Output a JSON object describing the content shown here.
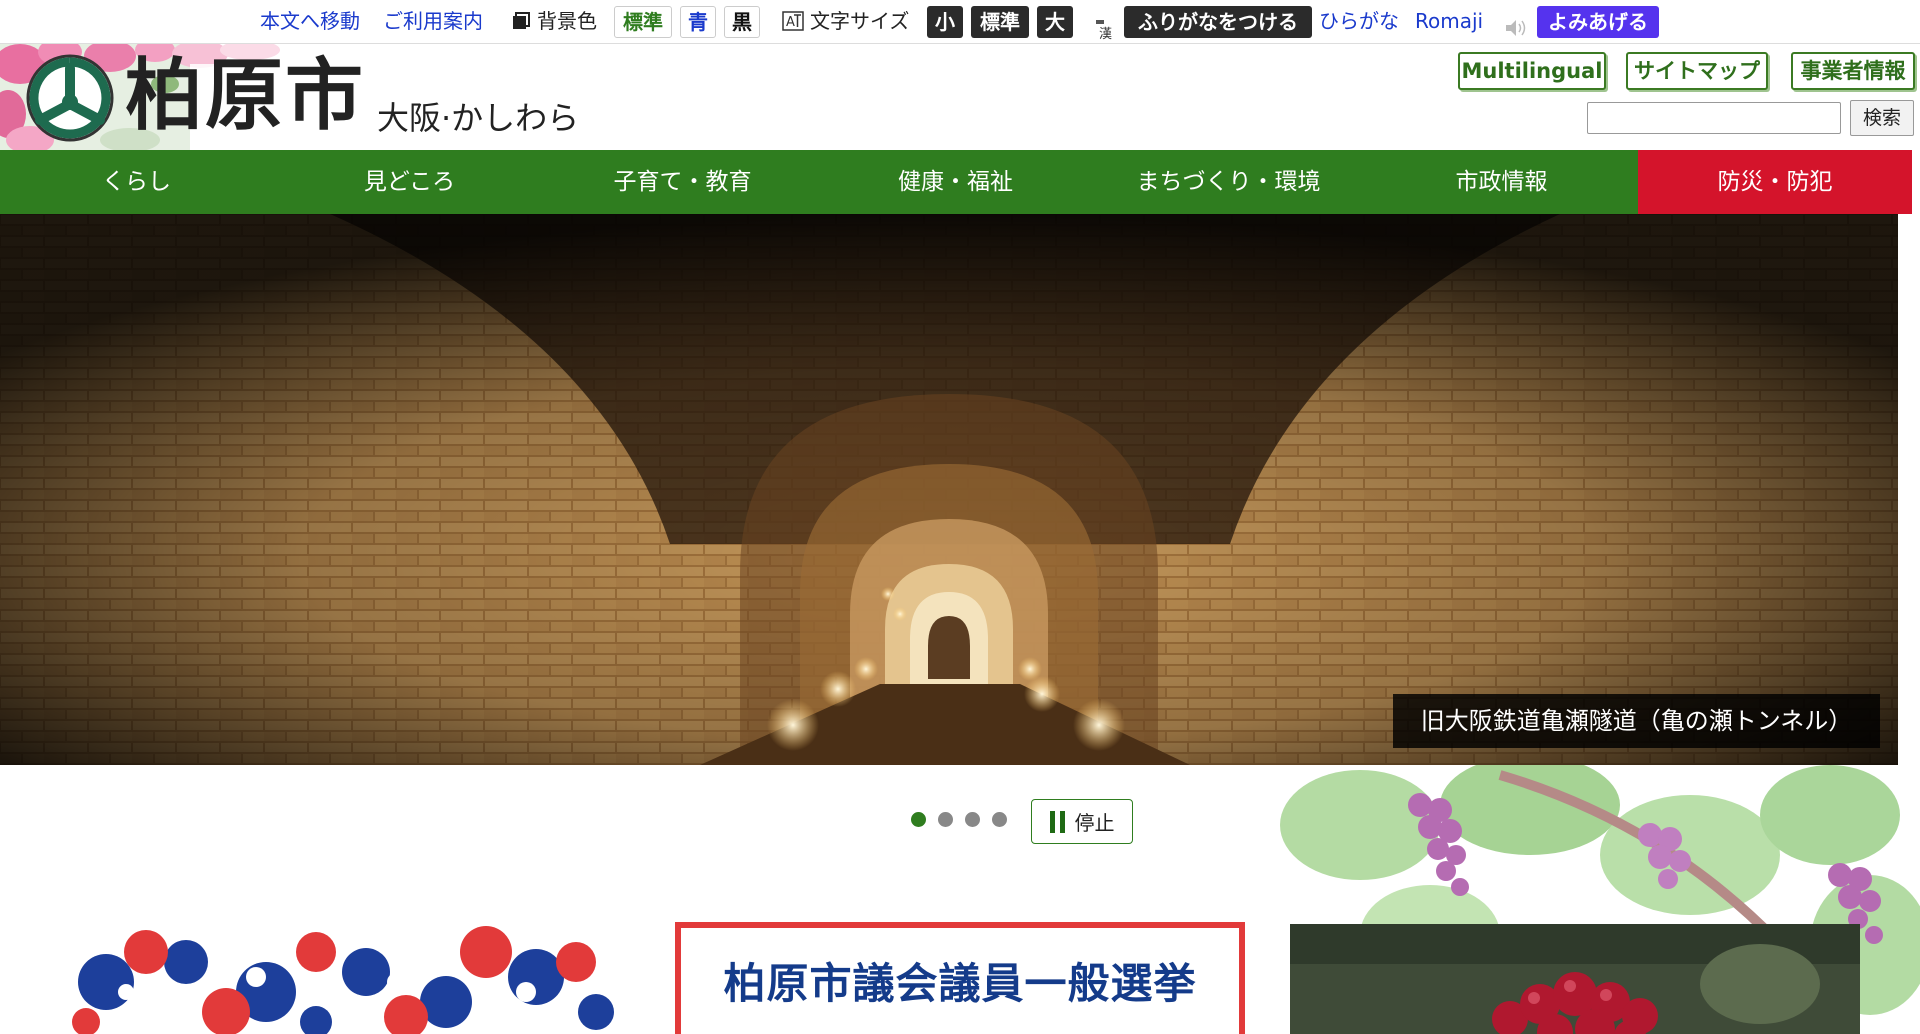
{
  "util": {
    "skip_link": "本文へ移動",
    "guide_link": "ご利用案内",
    "bg_label": "背景色",
    "bg_standard": "標準",
    "bg_blue": "青",
    "bg_black": "黒",
    "font_label": "文字サイズ",
    "font_small": "小",
    "font_standard": "標準",
    "font_large": "大",
    "furigana": "ふりがなをつける",
    "hiragana": "ひらがな",
    "romaji": "Romaji",
    "read_aloud": "よみあげる"
  },
  "header": {
    "title": "柏原市",
    "subtitle": "大阪·かしわら",
    "multilingual": "Multilingual",
    "sitemap": "サイトマップ",
    "business": "事業者情報",
    "search_button": "検索"
  },
  "nav": {
    "items": [
      "くらし",
      "見どころ",
      "子育て・教育",
      "健康・福祉",
      "まちづくり・環境",
      "市政情報",
      "防災・防犯"
    ]
  },
  "hero": {
    "caption": "旧大阪鉄道亀瀬隧道（亀の瀬トンネル）"
  },
  "slider": {
    "stop_label": "停止",
    "slide_count": 4,
    "active_index": 0
  },
  "banners": {
    "election_title": "柏原市議会議員一般選挙"
  },
  "colors": {
    "nav_green": "#2f7d1f",
    "nav_red": "#d4142b",
    "link_blue": "#1a3acc",
    "read_purple": "#5533ee"
  }
}
